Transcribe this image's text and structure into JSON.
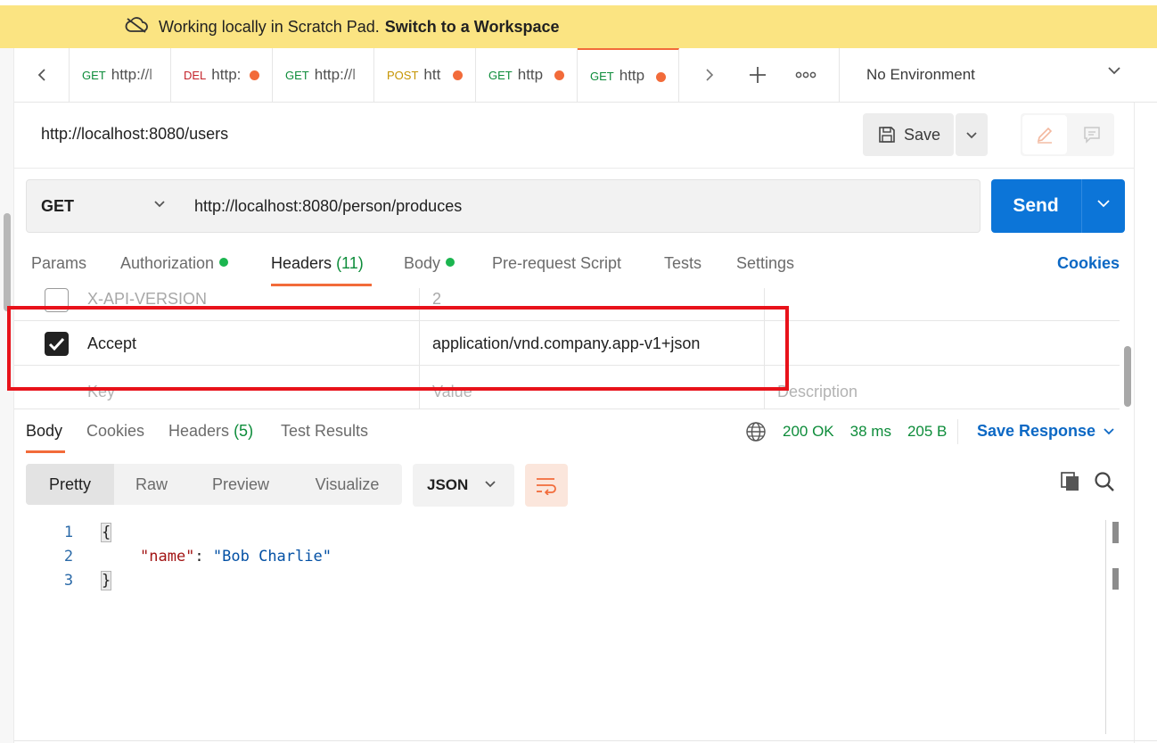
{
  "banner": {
    "text": "Working locally in Scratch Pad.",
    "link": "Switch to a Workspace"
  },
  "tabs": [
    {
      "method": "GET",
      "label": "http://l",
      "unsaved": false,
      "active": false
    },
    {
      "method": "DEL",
      "label": "http:",
      "unsaved": true,
      "active": false
    },
    {
      "method": "GET",
      "label": "http://l",
      "unsaved": false,
      "active": false
    },
    {
      "method": "POST",
      "label": "htt",
      "unsaved": true,
      "active": false
    },
    {
      "method": "GET",
      "label": "http",
      "unsaved": true,
      "active": false
    },
    {
      "method": "GET",
      "label": "http",
      "unsaved": true,
      "active": true
    }
  ],
  "environment": {
    "selected": "No Environment"
  },
  "request": {
    "title": "http://localhost:8080/users",
    "save_label": "Save",
    "method": "GET",
    "url": "http://localhost:8080/person/produces",
    "send_label": "Send"
  },
  "request_tabs": {
    "params": "Params",
    "authorization": "Authorization",
    "headers": "Headers",
    "headers_count": "(11)",
    "body": "Body",
    "prerequest": "Pre-request Script",
    "tests": "Tests",
    "settings": "Settings",
    "cookies": "Cookies"
  },
  "headers_table": {
    "rows": [
      {
        "checked": false,
        "key": "X-API-VERSION",
        "value": "2",
        "description": ""
      },
      {
        "checked": true,
        "key": "Accept",
        "value": "application/vnd.company.app-v1+json",
        "description": ""
      }
    ],
    "placeholder": {
      "key": "Key",
      "value": "Value",
      "description": "Description"
    }
  },
  "response_tabs": {
    "body": "Body",
    "cookies": "Cookies",
    "headers": "Headers",
    "headers_count": "(5)",
    "test_results": "Test Results"
  },
  "response_status": {
    "status": "200 OK",
    "time": "38 ms",
    "size": "205 B",
    "save_response": "Save Response"
  },
  "view_modes": [
    "Pretty",
    "Raw",
    "Preview",
    "Visualize"
  ],
  "active_view_mode": "Pretty",
  "format": "JSON",
  "code": {
    "line_numbers": [
      "1",
      "2",
      "3"
    ],
    "open_brace": "{",
    "key": "\"name\"",
    "colon": ": ",
    "value": "\"Bob Charlie\"",
    "close_brace": "}"
  },
  "colors": {
    "accent": "#f26b3a",
    "send": "#0c75d8",
    "banner": "#fbe482",
    "success": "#0d8c3a",
    "highlight_box": "#e8121a"
  }
}
